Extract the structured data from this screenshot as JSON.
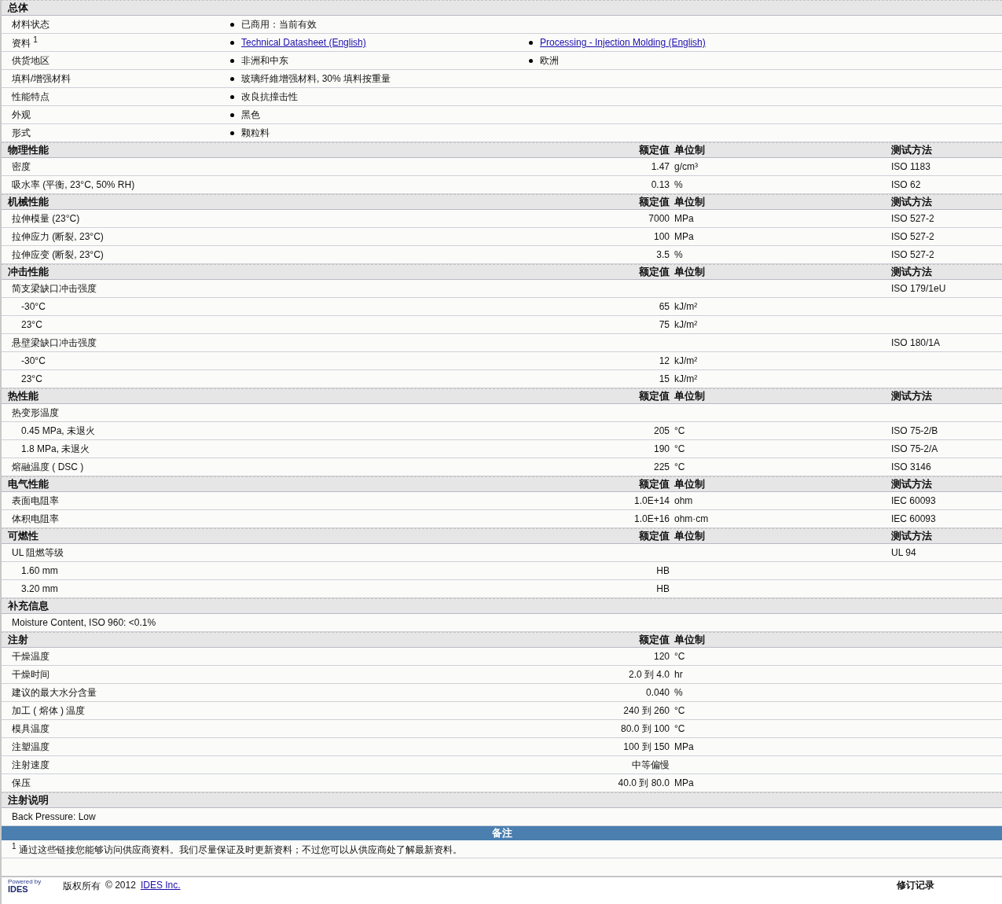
{
  "sections": [
    {
      "title": "总体",
      "rows": [
        {
          "kind": "info",
          "label": "材料状态",
          "items": [
            {
              "text": "已商用：当前有效",
              "link": false
            }
          ]
        },
        {
          "kind": "info",
          "label": "资料 $^{1}$",
          "items": [
            {
              "text": "Technical Datasheet (English)",
              "link": true
            },
            {
              "text": "Processing - Injection Molding (English)",
              "link": true
            }
          ]
        },
        {
          "kind": "info",
          "label": "供货地区",
          "items": [
            {
              "text": "非洲和中东",
              "link": false
            },
            {
              "text": "欧洲",
              "link": false
            }
          ]
        },
        {
          "kind": "info",
          "label": "填料/增强材料",
          "items": [
            {
              "text": "玻璃纤維增强材料, 30% 填料按重量",
              "link": false
            }
          ]
        },
        {
          "kind": "info",
          "label": "性能特点",
          "items": [
            {
              "text": "改良抗撞击性",
              "link": false
            }
          ]
        },
        {
          "kind": "info",
          "label": "外观",
          "items": [
            {
              "text": "黑色",
              "link": false
            }
          ]
        },
        {
          "kind": "info",
          "label": "形式",
          "items": [
            {
              "text": "颗粒料",
              "link": false
            }
          ]
        }
      ]
    },
    {
      "title": "物理性能",
      "headers": {
        "value": "额定值",
        "unit": "单位制",
        "method": "测试方法"
      },
      "rows": [
        {
          "kind": "prop",
          "label": "密度",
          "value": "1.47",
          "unit": "g/cm³",
          "method": "ISO 1183"
        },
        {
          "kind": "prop",
          "label": "吸水率  (平衡, 23°C, 50% RH)",
          "value": "0.13",
          "unit": "%",
          "method": "ISO 62"
        }
      ]
    },
    {
      "title": "机械性能",
      "headers": {
        "value": "额定值",
        "unit": "单位制",
        "method": "测试方法"
      },
      "rows": [
        {
          "kind": "prop",
          "label": "拉伸模量  (23°C)",
          "value": "7000",
          "unit": "MPa",
          "method": "ISO 527-2"
        },
        {
          "kind": "prop",
          "label": "拉伸应力  (断裂, 23°C)",
          "value": "100",
          "unit": "MPa",
          "method": "ISO 527-2"
        },
        {
          "kind": "prop",
          "label": "拉伸应变  (断裂, 23°C)",
          "value": "3.5",
          "unit": "%",
          "method": "ISO 527-2"
        }
      ]
    },
    {
      "title": "冲击性能",
      "headers": {
        "value": "额定值",
        "unit": "单位制",
        "method": "测试方法"
      },
      "rows": [
        {
          "kind": "prop",
          "label": "简支梁缺口冲击强度",
          "method": "ISO 179/1eU",
          "children": [
            {
              "kind": "prop",
              "label": "-30°C",
              "value": "65",
              "unit": "kJ/m²"
            },
            {
              "kind": "prop",
              "label": "23°C",
              "value": "75",
              "unit": "kJ/m²"
            }
          ]
        },
        {
          "kind": "prop",
          "label": "悬壁梁缺口冲击强度",
          "method": "ISO 180/1A",
          "children": [
            {
              "kind": "prop",
              "label": "-30°C",
              "value": "12",
              "unit": "kJ/m²"
            },
            {
              "kind": "prop",
              "label": "23°C",
              "value": "15",
              "unit": "kJ/m²"
            }
          ]
        }
      ]
    },
    {
      "title": "热性能",
      "headers": {
        "value": "额定值",
        "unit": "单位制",
        "method": "测试方法"
      },
      "rows": [
        {
          "kind": "prop",
          "label": "热变形温度",
          "children": [
            {
              "kind": "prop",
              "label": "0.45 MPa, 未退火",
              "value": "205",
              "unit": "°C",
              "method": "ISO 75-2/B"
            },
            {
              "kind": "prop",
              "label": "1.8 MPa, 未退火",
              "value": "190",
              "unit": "°C",
              "method": "ISO 75-2/A"
            }
          ]
        },
        {
          "kind": "prop",
          "label": "熔融温度 ( DSC )",
          "value": "225",
          "unit": "°C",
          "method": "ISO 3146"
        }
      ]
    },
    {
      "title": "电气性能",
      "headers": {
        "value": "额定值",
        "unit": "单位制",
        "method": "测试方法"
      },
      "rows": [
        {
          "kind": "prop",
          "label": "表面电阻率",
          "value": "1.0E+14",
          "unit": "ohm",
          "method": "IEC 60093"
        },
        {
          "kind": "prop",
          "label": "体积电阻率",
          "value": "1.0E+16",
          "unit": "ohm·cm",
          "method": "IEC 60093"
        }
      ]
    },
    {
      "title": "可燃性",
      "headers": {
        "value": "额定值",
        "unit": "单位制",
        "method": "测试方法"
      },
      "rows": [
        {
          "kind": "prop",
          "label": "UL 阻燃等级",
          "method": "UL 94",
          "children": [
            {
              "kind": "prop",
              "label": "1.60 mm",
              "value": "HB"
            },
            {
              "kind": "prop",
              "label": "3.20 mm",
              "value": "HB"
            }
          ]
        }
      ]
    },
    {
      "title": "补充信息",
      "rows": [
        {
          "kind": "note",
          "label": "Moisture Content, ISO 960: <0.1%"
        }
      ]
    },
    {
      "title": "注射",
      "headers": {
        "value": "额定值",
        "unit": "单位制"
      },
      "rows": [
        {
          "kind": "prop",
          "label": "干燥温度",
          "value": "120",
          "unit": "°C"
        },
        {
          "kind": "prop",
          "label": "干燥时间",
          "value": "2.0 到  4.0",
          "unit": "hr"
        },
        {
          "kind": "prop",
          "label": "建议的最大水分含量",
          "value": "0.040",
          "unit": "%"
        },
        {
          "kind": "prop",
          "label": "加工 ( 熔体 ) 温度",
          "value": "240 到  260",
          "unit": "°C"
        },
        {
          "kind": "prop",
          "label": "模具温度",
          "value": "80.0 到  100",
          "unit": "°C"
        },
        {
          "kind": "prop",
          "label": "注塑温度",
          "value": "100 到  150",
          "unit": "MPa"
        },
        {
          "kind": "prop",
          "label": "注射速度",
          "value": "中等偏慢"
        },
        {
          "kind": "prop",
          "label": "保压",
          "value": "40.0 到  80.0",
          "unit": "MPa"
        }
      ]
    },
    {
      "title": "注射说明",
      "rows": [
        {
          "kind": "note",
          "label": "Back Pressure: Low"
        }
      ]
    }
  ],
  "notes": {
    "title": "备注",
    "footnote": "$^{1}$ 通过这些链接您能够访问供应商资料。我们尽量保证及时更新资料；不过您可以从供应商处了解最新资料。"
  },
  "footer": {
    "logo_top": "Powered by",
    "logo_name": "IDES",
    "copyright": "版权所有",
    "year": "© 2012",
    "company": "IDES Inc.",
    "revision_title": "修订记录"
  }
}
